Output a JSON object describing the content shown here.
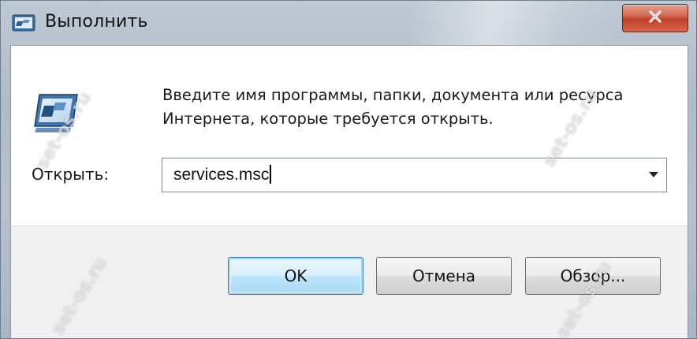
{
  "window": {
    "title": "Выполнить",
    "close_glyph": "✕"
  },
  "content": {
    "prompt_line1": "Введите имя программы, папки, документа или ресурса",
    "prompt_line2": "Интернета, которые требуется открыть.",
    "open_label": "Открыть:",
    "open_value": "services.msc"
  },
  "buttons": {
    "ok": "OK",
    "cancel": "Отмена",
    "browse": "Обзор..."
  },
  "watermarks": {
    "text": "set-os.ru"
  },
  "icons": {
    "title": "run-icon",
    "main": "run-icon",
    "close": "close-icon",
    "dropdown": "chevron-down-icon"
  },
  "colors": {
    "close_button": "#c0402a",
    "ok_border": "#3c7fb1",
    "frame": "#aebbc8"
  }
}
